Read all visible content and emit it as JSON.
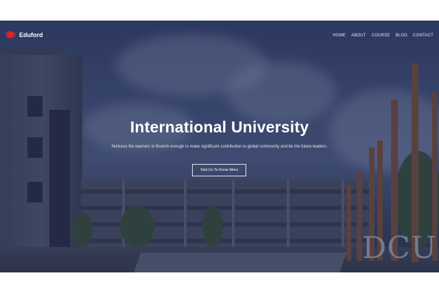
{
  "brand": {
    "name": "Eduford",
    "icon": "graduation-cap-icon",
    "accent": "#e02424"
  },
  "nav": {
    "items": [
      {
        "label": "HOME"
      },
      {
        "label": "ABOUT"
      },
      {
        "label": "COURSE"
      },
      {
        "label": "BLOG"
      },
      {
        "label": "CONTACT"
      }
    ]
  },
  "hero": {
    "title": "International University",
    "subtitle": "Nurtures the learners to flourish enough to make significant contribution to global community and be the future leaders.",
    "cta_label": "Visit Us To Know More",
    "sign_text": "DCU"
  }
}
